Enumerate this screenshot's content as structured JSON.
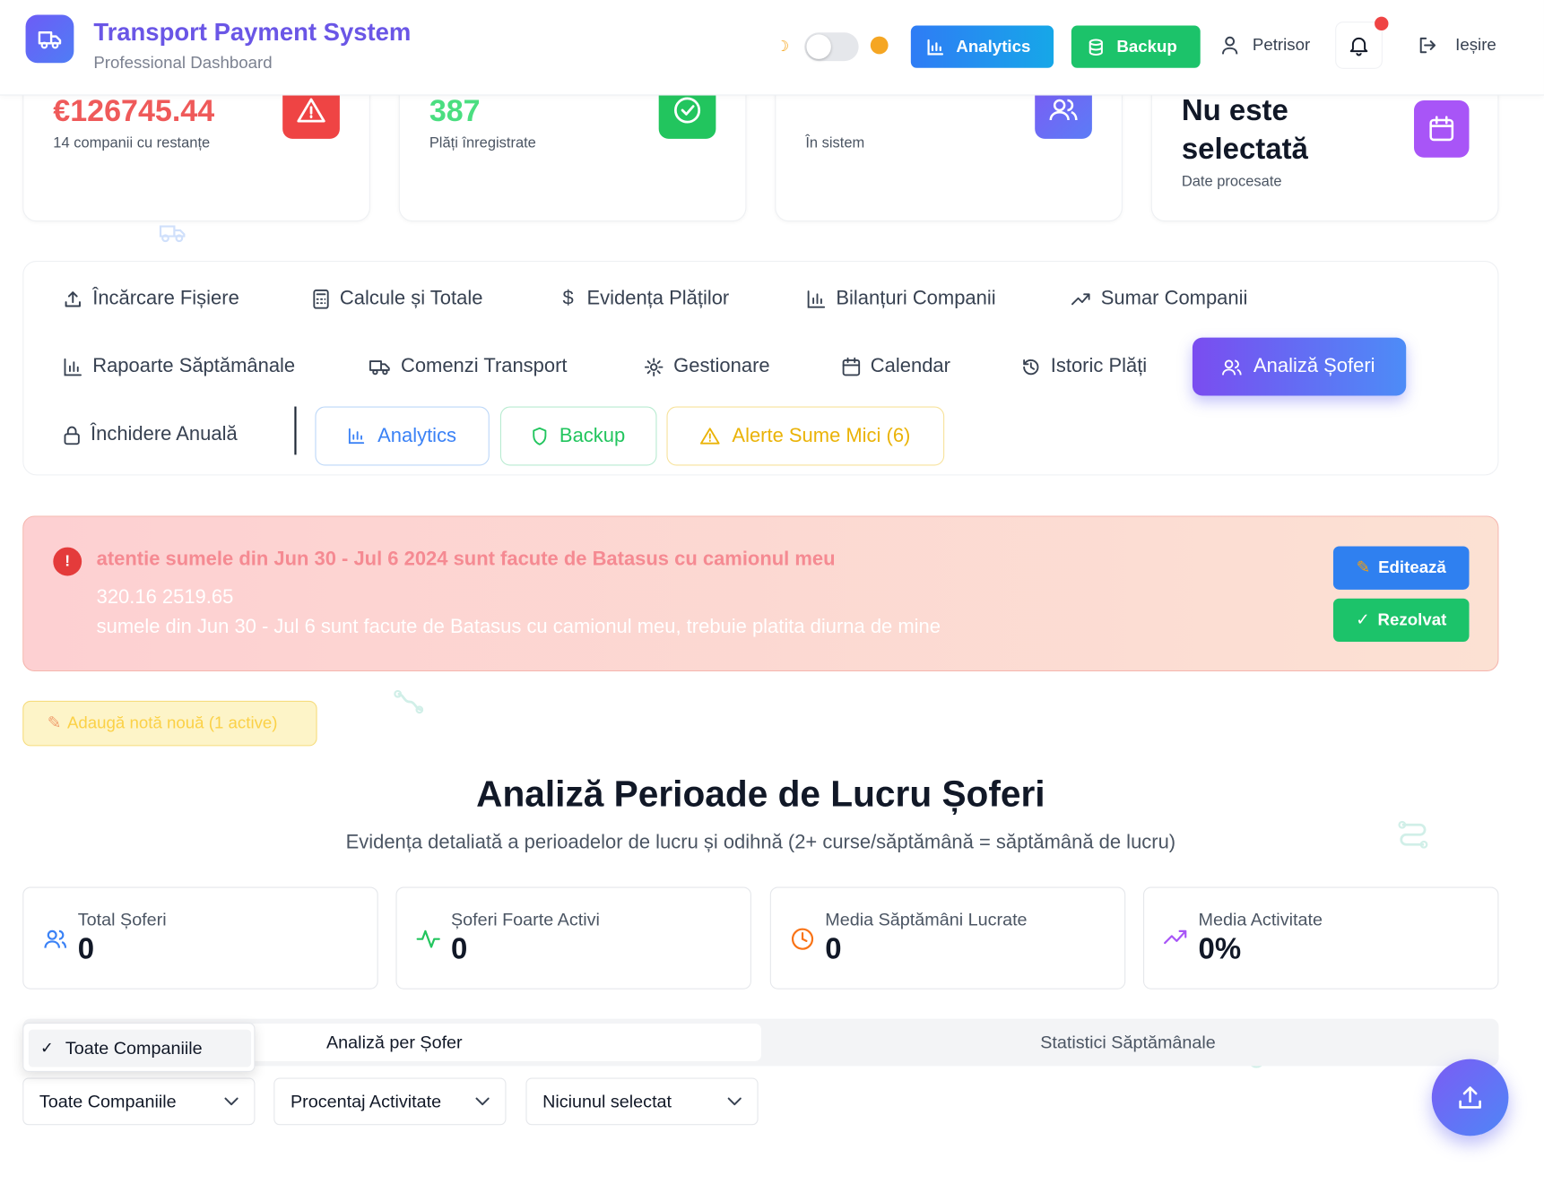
{
  "header": {
    "title": "Transport Payment System",
    "subtitle": "Professional Dashboard",
    "analytics_label": "Analytics",
    "backup_label": "Backup",
    "user_name": "Petrisor",
    "logout_label": "Ieșire",
    "theme_toggle": "light"
  },
  "stats": [
    {
      "value": "€126745.44",
      "label": "14 companii cu restanțe",
      "color": "#ef4444",
      "icon": "warning-icon"
    },
    {
      "value": "387",
      "label": "Plăți înregistrate",
      "color": "#22c55e",
      "icon": "check-circle-icon"
    },
    {
      "value": "",
      "label": "În sistem",
      "color": "#6366f1",
      "icon": "users-icon"
    },
    {
      "value": "Nu este selectată",
      "label": "Date procesate",
      "color": "#111827",
      "icon": "calendar-icon"
    }
  ],
  "nav": {
    "items": [
      "Încărcare Fișiere",
      "Calcule și Totale",
      "Evidența Plăților",
      "Bilanțuri Companii",
      "Sumar Companii",
      "Rapoarte Săptămânale",
      "Comenzi Transport",
      "Gestionare",
      "Calendar",
      "Istoric Plăți",
      "Analiză Șoferi",
      "Închidere Anuală"
    ],
    "active": "Analiză Șoferi",
    "analytics_label": "Analytics",
    "backup_label": "Backup",
    "alerts_label": "Alerte Sume Mici (6)"
  },
  "alert": {
    "title": "atentie sumele din Jun 30 - Jul 6 2024 sunt facute de Batasus cu camionul meu",
    "line1": "320.16 2519.65",
    "line2": "sumele din Jun 30 - Jul 6 sunt facute de Batasus cu camionul meu, trebuie platita diurna de mine",
    "edit_label": "Editează",
    "resolve_label": "Rezolvat"
  },
  "note_button": "Adaugă notă nouă (1 active)",
  "section": {
    "title": "Analiză Perioade de Lucru Șoferi",
    "subtitle": "Evidența detaliată a perioadelor de lucru și odihnă (2+ curse/săptămână = săptămână de lucru)"
  },
  "metrics": [
    {
      "label": "Total Șoferi",
      "value": "0"
    },
    {
      "label": "Șoferi Foarte Activi",
      "value": "0"
    },
    {
      "label": "Media Săptămâni Lucrate",
      "value": "0"
    },
    {
      "label": "Media Activitate",
      "value": "0%"
    }
  ],
  "tabs": {
    "tab1": "Analiză per Șofer",
    "tab2": "Statistici Săptămânale"
  },
  "dropdown_open_option": "Toate Companiile",
  "filters": {
    "company": "Toate Companiile",
    "sort": "Procentaj Activitate",
    "driver": "Niciunul selectat"
  }
}
